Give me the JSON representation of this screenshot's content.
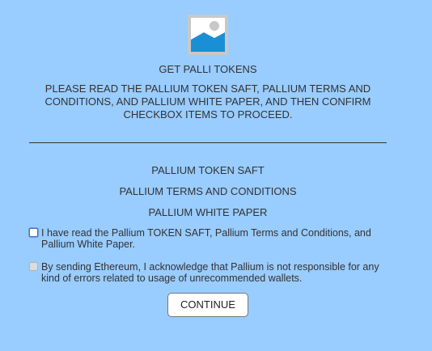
{
  "header": {
    "logo_icon": "image-placeholder-icon",
    "title": "GET PALLI TOKENS",
    "intro": "PLEASE READ THE PALLIUM TOKEN SAFT, PALLIUM TERMS AND CONDITIONS, AND PALLIUM WHITE PAPER, AND THEN CONFIRM CHECKBOX ITEMS TO PROCEED."
  },
  "documents": {
    "saft": "PALLIUM TOKEN SAFT",
    "terms": "PALLIUM TERMS AND CONDITIONS",
    "white_paper": "PALLIUM WHITE PAPER"
  },
  "checkboxes": [
    {
      "label": "I have read the Pallium TOKEN SAFT, Pallium Terms and Conditions, and Pallium White Paper.",
      "checked": false,
      "disabled": false
    },
    {
      "label": "By sending Ethereum, I acknowledge that Pallium is not responsible for any kind of errors related to usage of unrecommended wallets.",
      "checked": false,
      "disabled": true
    }
  ],
  "actions": {
    "continue_label": "CONTINUE"
  },
  "colors": {
    "background": "#99ccff",
    "text": "#333333",
    "logo_sky": "#1a8fd6",
    "logo_frame": "#c8c8c8"
  }
}
